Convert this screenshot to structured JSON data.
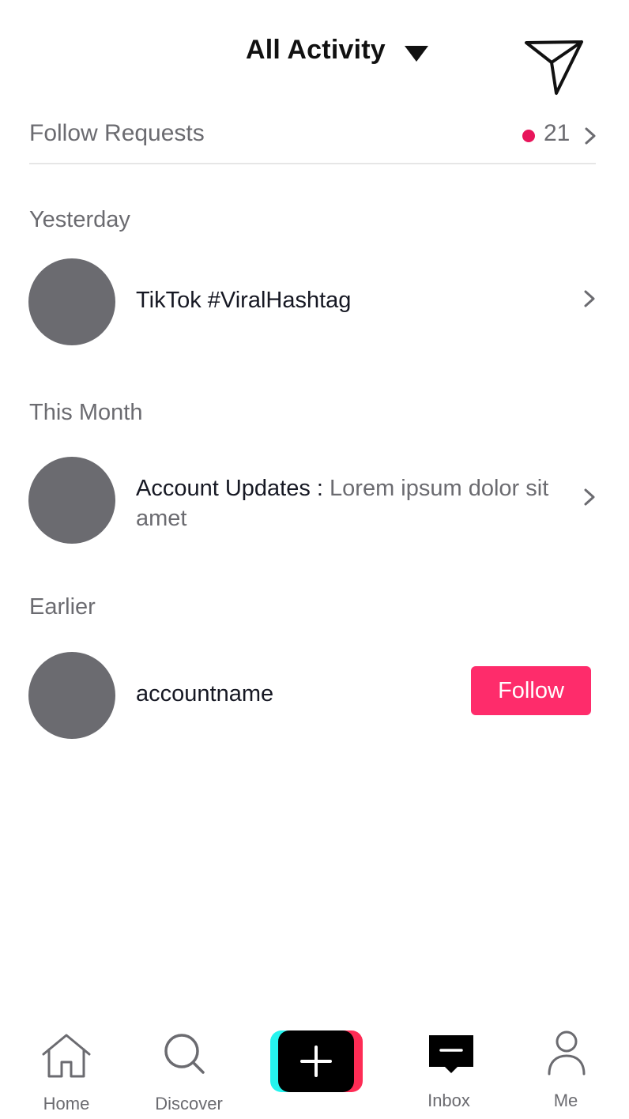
{
  "header": {
    "title": "All Activity",
    "dropdown_icon": "caret-down-icon",
    "send_icon": "paper-plane-icon"
  },
  "follow_requests": {
    "label": "Follow Requests",
    "count": "21",
    "badge_color": "#e8155b"
  },
  "sections": {
    "yesterday": "Yesterday",
    "this_month": "This Month",
    "earlier": "Earlier"
  },
  "notifications": {
    "hashtag": {
      "title": "TikTok #ViralHashtag"
    },
    "account_updates": {
      "title": "Account Updates :",
      "body": "Lorem ipsum dolor sit amet"
    },
    "follower": {
      "username": "accountname",
      "action_label": "Follow"
    }
  },
  "tabs": [
    {
      "label": "Home",
      "icon": "home-icon"
    },
    {
      "label": "Discover",
      "icon": "search-icon"
    },
    {
      "label": "",
      "icon": "create-plus-icon"
    },
    {
      "label": "Inbox",
      "icon": "inbox-message-icon"
    },
    {
      "label": "Me",
      "icon": "profile-icon"
    }
  ],
  "colors": {
    "accent": "#fe2c6b",
    "avatar_placeholder": "#6b6b70",
    "muted_text": "#6b6b70",
    "create_cyan": "#25f4ee",
    "create_pink": "#fe2c55"
  }
}
